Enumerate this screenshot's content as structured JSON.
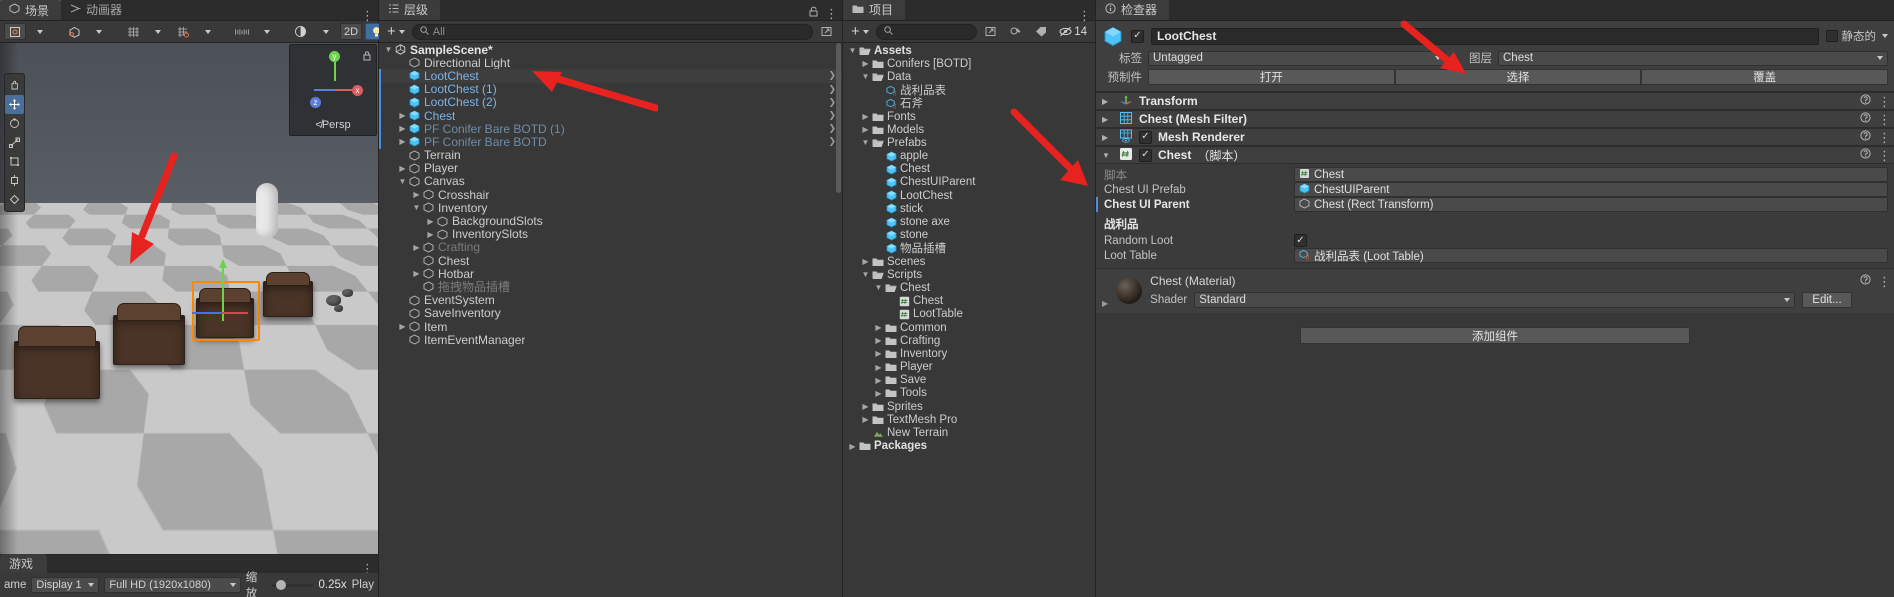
{
  "scene": {
    "tab_scene": "场景",
    "tab_animator": "动画器",
    "toolbar": {
      "pivot_label": "",
      "btn_2d": "2D",
      "audio_icon": "audio-icon",
      "light_icon": "light-icon",
      "fx_icon": "effects-icon"
    },
    "gizmo_label": "≮Persp",
    "axis_x": "x",
    "axis_y": "y",
    "axis_z": "z"
  },
  "game": {
    "tab_game": "游戏",
    "tab_name_cut": "ame",
    "display": "Display 1",
    "resolution": "Full HD (1920x1080)",
    "scale_label": "缩放",
    "scale_value": "0.25x",
    "play_label": "Play"
  },
  "hierarchy": {
    "tab": "层级",
    "add_label": "+",
    "search_placeholder": "All",
    "items": [
      {
        "label": "SampleScene*",
        "depth": 0,
        "twisty": "down",
        "icon": "unity-scene-icon",
        "style": "scene",
        "prefab_bar": false,
        "chev": false
      },
      {
        "label": "Directional Light",
        "depth": 1,
        "twisty": "none",
        "icon": "gameobject-icon",
        "style": "normal",
        "prefab_bar": false,
        "chev": false
      },
      {
        "label": "LootChest",
        "depth": 1,
        "twisty": "none",
        "icon": "prefab-icon",
        "style": "prefab",
        "prefab_bar": true,
        "chev": true,
        "selected_row": true
      },
      {
        "label": "LootChest (1)",
        "depth": 1,
        "twisty": "none",
        "icon": "prefab-icon",
        "style": "prefab",
        "prefab_bar": true,
        "chev": true
      },
      {
        "label": "LootChest (2)",
        "depth": 1,
        "twisty": "none",
        "icon": "prefab-icon",
        "style": "prefab",
        "prefab_bar": true,
        "chev": true
      },
      {
        "label": "Chest",
        "depth": 1,
        "twisty": "right",
        "icon": "prefab-icon",
        "style": "prefab",
        "prefab_bar": true,
        "chev": true
      },
      {
        "label": "PF Conifer Bare BOTD (1)",
        "depth": 1,
        "twisty": "right",
        "icon": "prefab-icon",
        "style": "prefab-dim",
        "prefab_bar": true,
        "chev": true
      },
      {
        "label": "PF Conifer Bare BOTD",
        "depth": 1,
        "twisty": "right",
        "icon": "prefab-icon",
        "style": "prefab-dim",
        "prefab_bar": true,
        "chev": true
      },
      {
        "label": "Terrain",
        "depth": 1,
        "twisty": "none",
        "icon": "gameobject-icon",
        "style": "normal",
        "prefab_bar": false,
        "chev": false
      },
      {
        "label": "Player",
        "depth": 1,
        "twisty": "right",
        "icon": "gameobject-icon",
        "style": "normal",
        "prefab_bar": false,
        "chev": false
      },
      {
        "label": "Canvas",
        "depth": 1,
        "twisty": "down",
        "icon": "gameobject-icon",
        "style": "normal",
        "prefab_bar": false,
        "chev": false
      },
      {
        "label": "Crosshair",
        "depth": 2,
        "twisty": "right",
        "icon": "gameobject-icon",
        "style": "normal",
        "prefab_bar": false,
        "chev": false
      },
      {
        "label": "Inventory",
        "depth": 2,
        "twisty": "down",
        "icon": "gameobject-icon",
        "style": "normal",
        "prefab_bar": false,
        "chev": false
      },
      {
        "label": "BackgroundSlots",
        "depth": 3,
        "twisty": "right",
        "icon": "gameobject-icon",
        "style": "normal",
        "prefab_bar": false,
        "chev": false
      },
      {
        "label": "InventorySlots",
        "depth": 3,
        "twisty": "right",
        "icon": "gameobject-icon",
        "style": "normal",
        "prefab_bar": false,
        "chev": false
      },
      {
        "label": "Crafting",
        "depth": 2,
        "twisty": "right",
        "icon": "gameobject-icon",
        "style": "disabled",
        "prefab_bar": false,
        "chev": false
      },
      {
        "label": "Chest",
        "depth": 2,
        "twisty": "none",
        "icon": "gameobject-icon",
        "style": "normal",
        "prefab_bar": false,
        "chev": false
      },
      {
        "label": "Hotbar",
        "depth": 2,
        "twisty": "right",
        "icon": "gameobject-icon",
        "style": "normal",
        "prefab_bar": false,
        "chev": false
      },
      {
        "label": "拖拽物品插槽",
        "depth": 2,
        "twisty": "none",
        "icon": "gameobject-icon",
        "style": "disabled",
        "prefab_bar": false,
        "chev": false
      },
      {
        "label": "EventSystem",
        "depth": 1,
        "twisty": "none",
        "icon": "gameobject-icon",
        "style": "normal",
        "prefab_bar": false,
        "chev": false
      },
      {
        "label": "SaveInventory",
        "depth": 1,
        "twisty": "none",
        "icon": "gameobject-icon",
        "style": "normal",
        "prefab_bar": false,
        "chev": false
      },
      {
        "label": "Item",
        "depth": 1,
        "twisty": "right",
        "icon": "gameobject-icon",
        "style": "normal",
        "prefab_bar": false,
        "chev": false
      },
      {
        "label": "ItemEventManager",
        "depth": 1,
        "twisty": "none",
        "icon": "gameobject-icon",
        "style": "normal",
        "prefab_bar": false,
        "chev": false
      }
    ]
  },
  "project": {
    "tab": "项目",
    "add_label": "+",
    "search_placeholder": "",
    "hidden_count": "14",
    "items": [
      {
        "label": "Assets",
        "depth": 0,
        "twisty": "down",
        "icon": "folder-open-icon",
        "bold": true
      },
      {
        "label": "Conifers [BOTD]",
        "depth": 1,
        "twisty": "right",
        "icon": "folder-icon",
        "bold": false
      },
      {
        "label": "Data",
        "depth": 1,
        "twisty": "down",
        "icon": "folder-open-icon",
        "bold": false
      },
      {
        "label": "战利品表",
        "depth": 2,
        "twisty": "none",
        "icon": "scriptable-object-icon",
        "bold": false
      },
      {
        "label": "石斧",
        "depth": 2,
        "twisty": "none",
        "icon": "scriptable-object-icon",
        "bold": false
      },
      {
        "label": "Fonts",
        "depth": 1,
        "twisty": "right",
        "icon": "folder-icon",
        "bold": false
      },
      {
        "label": "Models",
        "depth": 1,
        "twisty": "right",
        "icon": "folder-icon",
        "bold": false
      },
      {
        "label": "Prefabs",
        "depth": 1,
        "twisty": "down",
        "icon": "folder-open-icon",
        "bold": false
      },
      {
        "label": "apple",
        "depth": 2,
        "twisty": "none",
        "icon": "prefab-icon",
        "bold": false
      },
      {
        "label": "Chest",
        "depth": 2,
        "twisty": "none",
        "icon": "prefab-icon",
        "bold": false
      },
      {
        "label": "ChestUIParent",
        "depth": 2,
        "twisty": "none",
        "icon": "prefab-icon",
        "bold": false
      },
      {
        "label": "LootChest",
        "depth": 2,
        "twisty": "none",
        "icon": "prefab-icon",
        "bold": false
      },
      {
        "label": "stick",
        "depth": 2,
        "twisty": "none",
        "icon": "prefab-icon",
        "bold": false
      },
      {
        "label": "stone axe",
        "depth": 2,
        "twisty": "none",
        "icon": "prefab-icon",
        "bold": false
      },
      {
        "label": "stone",
        "depth": 2,
        "twisty": "none",
        "icon": "prefab-icon",
        "bold": false
      },
      {
        "label": "物品插槽",
        "depth": 2,
        "twisty": "none",
        "icon": "prefab-icon",
        "bold": false
      },
      {
        "label": "Scenes",
        "depth": 1,
        "twisty": "right",
        "icon": "folder-icon",
        "bold": false
      },
      {
        "label": "Scripts",
        "depth": 1,
        "twisty": "down",
        "icon": "folder-open-icon",
        "bold": false
      },
      {
        "label": "Chest",
        "depth": 2,
        "twisty": "down",
        "icon": "folder-open-icon",
        "bold": false
      },
      {
        "label": "Chest",
        "depth": 3,
        "twisty": "none",
        "icon": "script-icon",
        "bold": false
      },
      {
        "label": "LootTable",
        "depth": 3,
        "twisty": "none",
        "icon": "script-icon",
        "bold": false
      },
      {
        "label": "Common",
        "depth": 2,
        "twisty": "right",
        "icon": "folder-icon",
        "bold": false
      },
      {
        "label": "Crafting",
        "depth": 2,
        "twisty": "right",
        "icon": "folder-icon",
        "bold": false
      },
      {
        "label": "Inventory",
        "depth": 2,
        "twisty": "right",
        "icon": "folder-icon",
        "bold": false
      },
      {
        "label": "Player",
        "depth": 2,
        "twisty": "right",
        "icon": "folder-icon",
        "bold": false
      },
      {
        "label": "Save",
        "depth": 2,
        "twisty": "right",
        "icon": "folder-icon",
        "bold": false
      },
      {
        "label": "Tools",
        "depth": 2,
        "twisty": "right",
        "icon": "folder-icon",
        "bold": false
      },
      {
        "label": "Sprites",
        "depth": 1,
        "twisty": "right",
        "icon": "folder-icon",
        "bold": false
      },
      {
        "label": "TextMesh Pro",
        "depth": 1,
        "twisty": "right",
        "icon": "folder-icon",
        "bold": false
      },
      {
        "label": "New Terrain",
        "depth": 1,
        "twisty": "none",
        "icon": "terrain-icon",
        "bold": false
      },
      {
        "label": "Packages",
        "depth": 0,
        "twisty": "right",
        "icon": "folder-icon",
        "bold": true
      }
    ]
  },
  "inspector": {
    "tab": "检查器",
    "object_name": "LootChest",
    "enabled": true,
    "static_label": "静态的",
    "tag_label": "标签",
    "tag_value": "Untagged",
    "layer_label": "图层",
    "layer_value": "Chest",
    "prefab_label": "预制件",
    "prefab_open": "打开",
    "prefab_select": "选择",
    "prefab_override": "覆盖",
    "components": [
      {
        "name": "Transform",
        "icon": "transform-icon",
        "has_checkbox": false,
        "checked": false,
        "expanded": false
      },
      {
        "name": "Chest (Mesh Filter)",
        "icon": "mesh-filter-icon",
        "has_checkbox": false,
        "checked": false,
        "expanded": false
      },
      {
        "name": "Mesh Renderer",
        "icon": "mesh-renderer-icon",
        "has_checkbox": true,
        "checked": true,
        "expanded": false
      }
    ],
    "script_component": {
      "name": "Chest",
      "suffix": "（脚本）",
      "icon": "script-icon",
      "checked": true,
      "script_row_label": "脚本",
      "script_row_value": "Chest",
      "properties": [
        {
          "label": "Chest UI Prefab",
          "value": "ChestUIParent",
          "icon": "prefab-icon",
          "bold": false,
          "marked": false
        },
        {
          "label": "Chest UI Parent",
          "value": "Chest (Rect Transform)",
          "icon": "rect-transform-icon",
          "bold": true,
          "marked": true
        }
      ],
      "section_title": "战利品",
      "section_props": [
        {
          "label": "Random Loot",
          "type": "checkbox",
          "checked": true
        },
        {
          "label": "Loot Table",
          "type": "object",
          "value": "战利品表 (Loot Table)",
          "icon": "scriptable-object-icon"
        }
      ]
    },
    "material": {
      "title": "Chest (Material)",
      "shader_label": "Shader",
      "shader_value": "Standard",
      "edit_label": "Edit..."
    },
    "add_component": "添加组件"
  },
  "colors": {
    "accent_blue": "#4a90d9",
    "prefab_blue": "#7cb4e8",
    "arrow_red": "#e8231f",
    "selection_orange": "#ff8800",
    "panel_bg": "#383838"
  }
}
